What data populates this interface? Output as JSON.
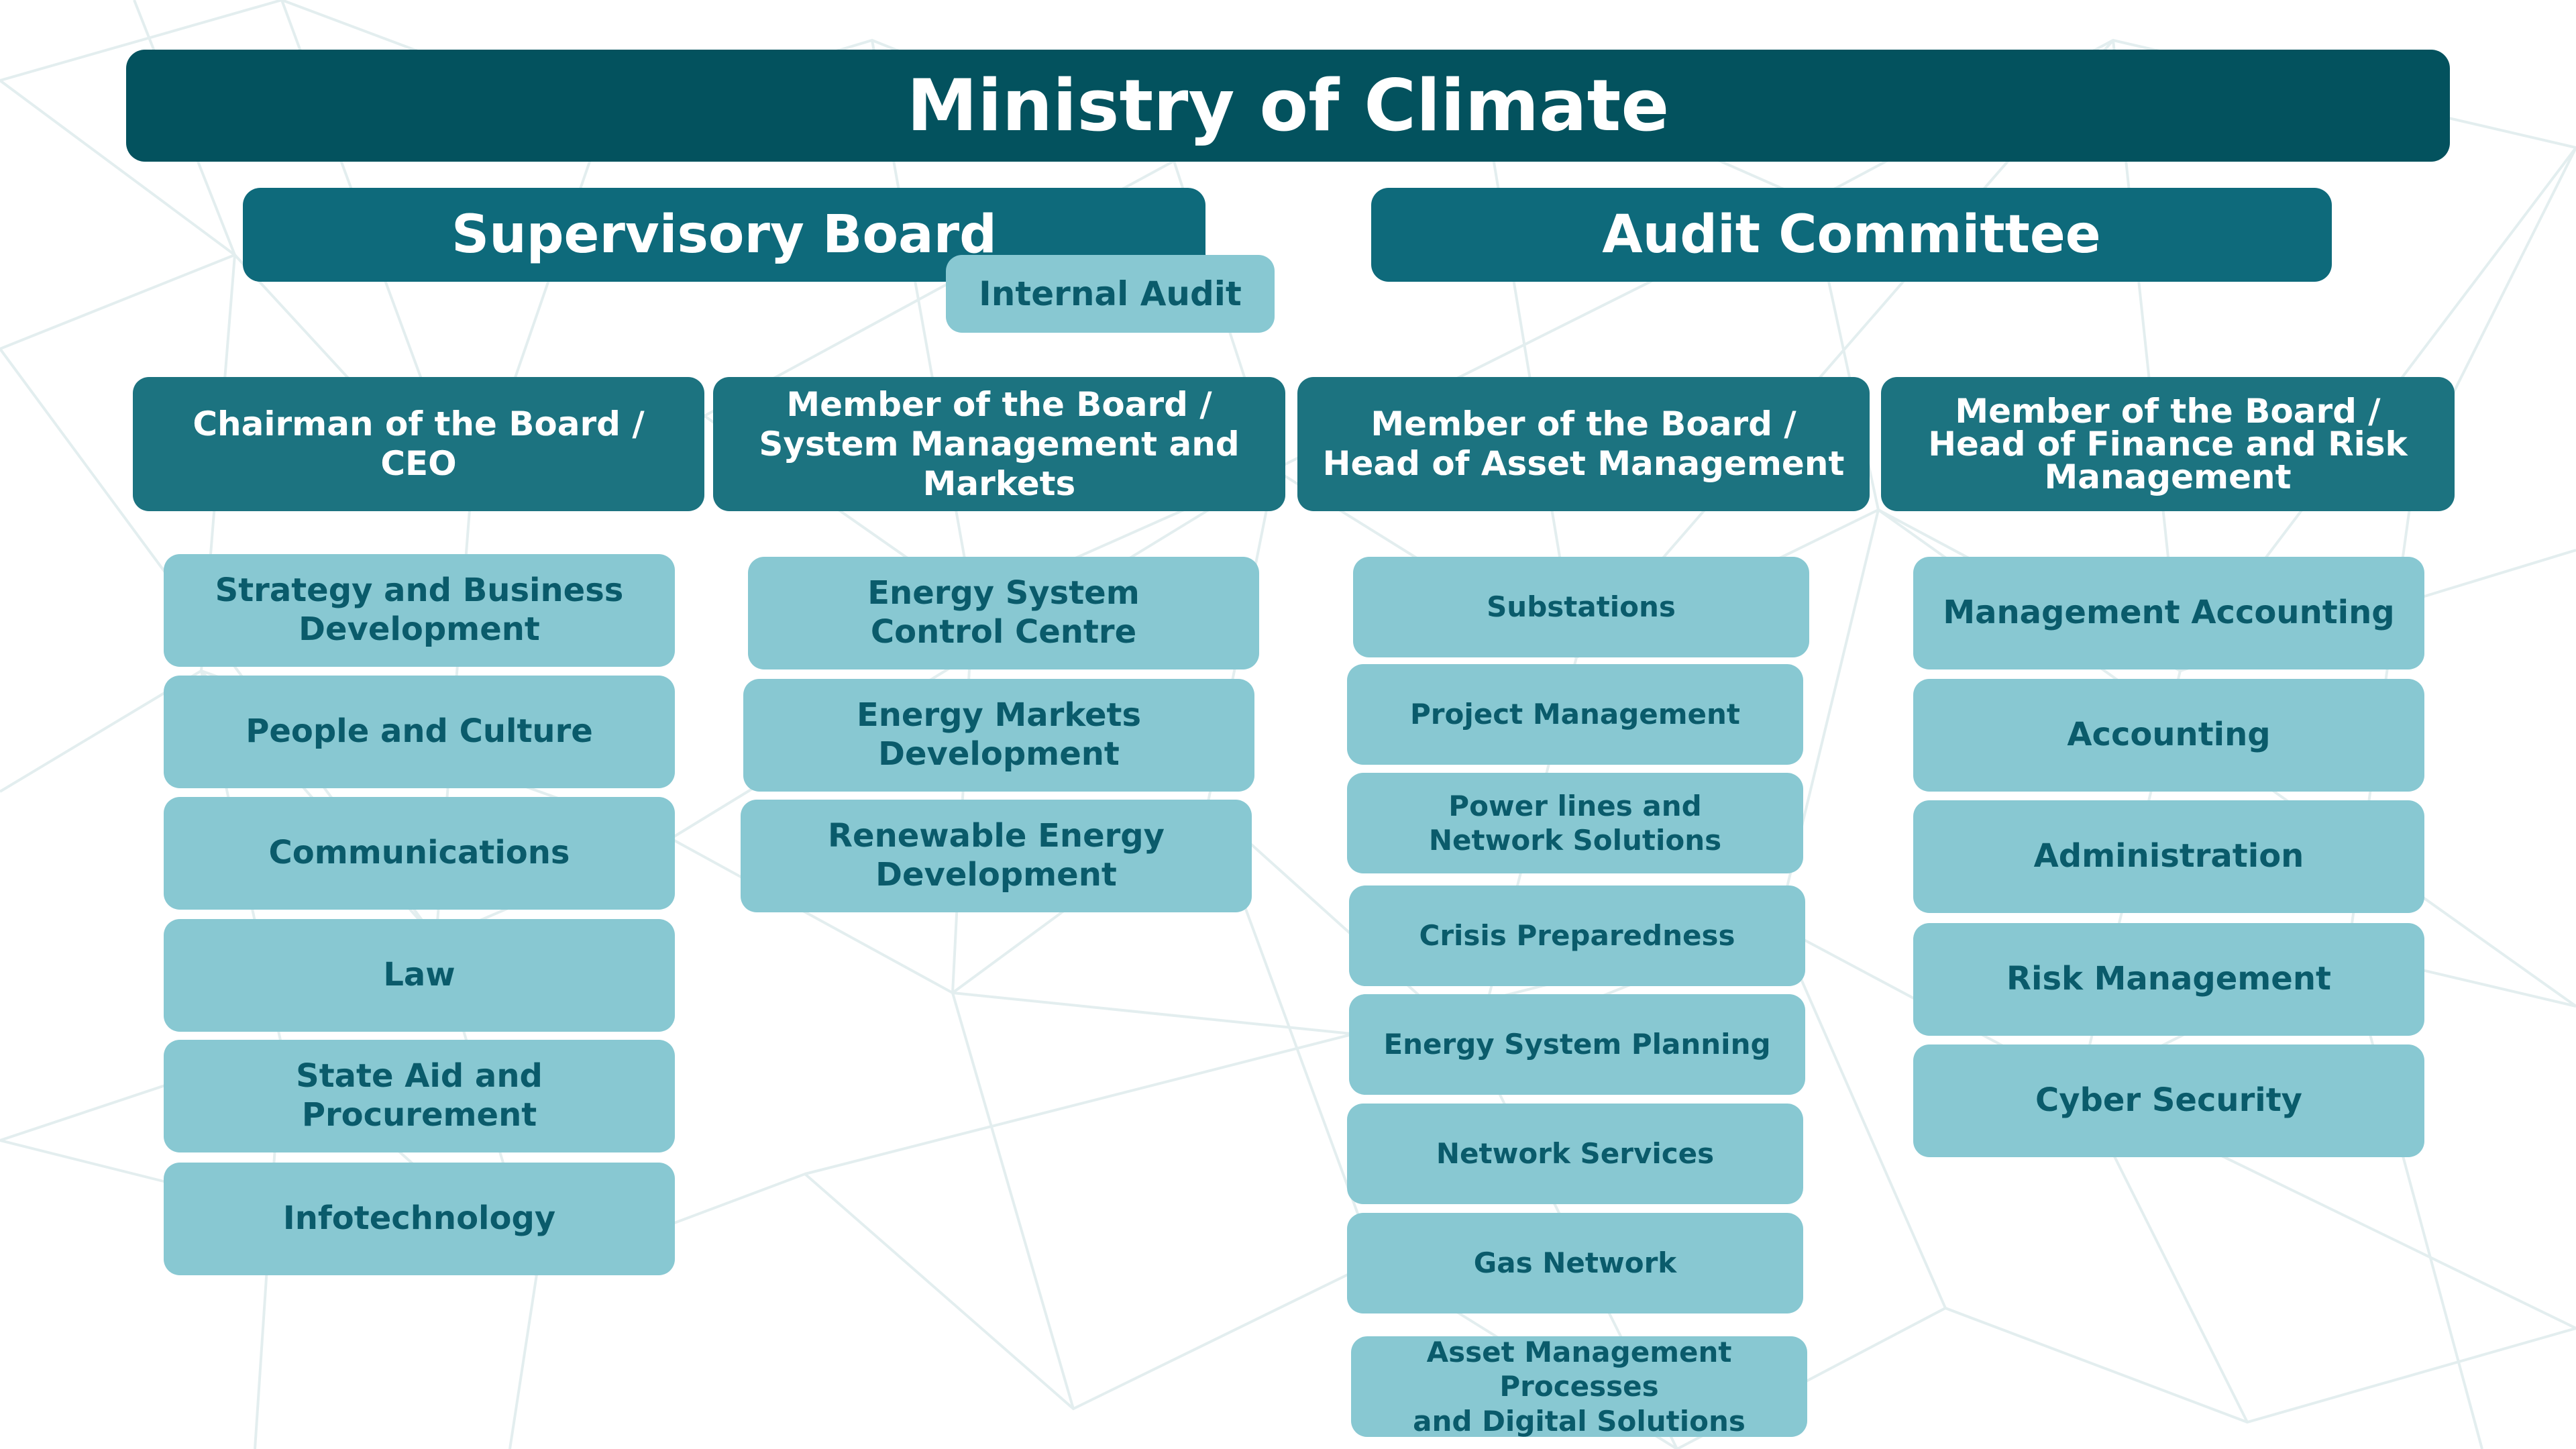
{
  "title": "Ministry of Climate",
  "boards": {
    "supervisory": "Supervisory Board",
    "audit_committee": "Audit Committee",
    "internal_audit": "Internal Audit"
  },
  "executives": [
    "Chairman of the Board /\nCEO",
    "Member of the Board /\nSystem Management and Markets",
    "Member of the Board /\nHead of Asset Management",
    "Member of the Board /\nHead of Finance and Risk\nManagement"
  ],
  "departments": {
    "ceo": [
      "Strategy and Business\nDevelopment",
      "People and Culture",
      "Communications",
      "Law",
      "State Aid and Procurement",
      "Infotechnology"
    ],
    "system_markets": [
      "Energy System\nControl Centre",
      "Energy Markets Development",
      "Renewable Energy\nDevelopment"
    ],
    "asset_management": [
      "Substations",
      "Project Management",
      "Power lines and\nNetwork Solutions",
      "Crisis Preparedness",
      "Energy System Planning",
      "Network Services",
      "Gas Network",
      "Asset Management Processes\nand Digital Solutions"
    ],
    "finance_risk": [
      "Management Accounting",
      "Accounting",
      "Administration",
      "Risk Management",
      "Cyber Security"
    ]
  },
  "colors": {
    "title_bg": "#03525e",
    "board_bg": "#0e6a7b",
    "executive_bg": "#1c7380",
    "department_bg": "#88c8d2",
    "department_text": "#0a5b6b",
    "background_lines": "#e3eeef"
  }
}
